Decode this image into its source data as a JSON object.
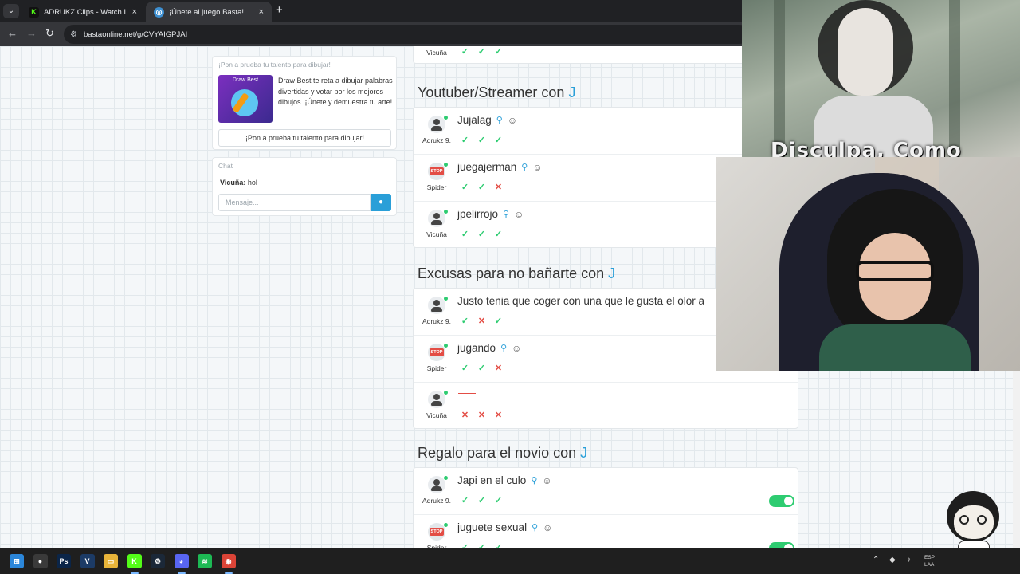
{
  "browser": {
    "tabs": [
      {
        "title": "ADRUKZ Clips - Watch Live on",
        "close": "×"
      },
      {
        "title": "¡Únete al juego Basta!",
        "close": "×"
      }
    ],
    "new_tab": "+",
    "url": "bastaonline.net/g/CVYAIGPJAI"
  },
  "promo": {
    "header": "¡Pon a prueba tu talento para dibujar!",
    "image_label": "Draw Best",
    "text": "Draw Best te reta a dibujar palabras divertidas y votar por los mejores dibujos. ¡Únete y demuestra tu arte!",
    "button": "¡Pon a prueba tu talento para dibujar!"
  },
  "chat": {
    "header": "Chat",
    "messages": [
      {
        "user": "Vicuña:",
        "text": " hol"
      }
    ],
    "placeholder": "Mensaje..."
  },
  "top_row": {
    "player": "Vicuña",
    "votes": [
      "ok",
      "ok",
      "ok"
    ]
  },
  "categories": [
    {
      "title": "Youtuber/Streamer con",
      "letter": "J",
      "answers": [
        {
          "player": "Adrukz 9.",
          "avatar": "person",
          "answer": "Jujalag",
          "votes": [
            "ok",
            "ok",
            "ok"
          ]
        },
        {
          "player": "Spider",
          "avatar": "stop",
          "answer": "juegajerman",
          "votes": [
            "ok",
            "ok",
            "no"
          ]
        },
        {
          "player": "Vicuña",
          "avatar": "person",
          "answer": "jpelirrojo",
          "votes": [
            "ok",
            "ok",
            "ok"
          ]
        }
      ]
    },
    {
      "title": "Excusas para no bañarte con",
      "letter": "J",
      "answers": [
        {
          "player": "Adrukz 9.",
          "avatar": "person",
          "answer": "Justo tenia que coger con una que le gusta el olor a",
          "votes": [
            "ok",
            "no",
            "ok"
          ]
        },
        {
          "player": "Spider",
          "avatar": "stop",
          "answer": "jugando",
          "votes": [
            "ok",
            "ok",
            "no"
          ]
        },
        {
          "player": "Vicuña",
          "avatar": "person",
          "answer": "",
          "votes": [
            "no",
            "no",
            "no"
          ]
        }
      ]
    },
    {
      "title": "Regalo para el novio con",
      "letter": "J",
      "answers": [
        {
          "player": "Adrukz 9.",
          "avatar": "person",
          "answer": "Japi en el culo",
          "votes": [
            "ok",
            "ok",
            "ok"
          ]
        },
        {
          "player": "Spider",
          "avatar": "stop",
          "answer": "juguete sexual",
          "votes": [
            "ok",
            "ok",
            "ok"
          ]
        }
      ]
    }
  ],
  "icons": {
    "ok": "✓",
    "no": "✕",
    "search": "search-icon",
    "emoji": "emoji-icon"
  },
  "overlay": {
    "caption": "Disculpa, Como"
  },
  "taskbar": {
    "apps": [
      "start",
      "obs",
      "photoshop",
      "vegas",
      "explorer",
      "kick",
      "steam",
      "discord",
      "spotify",
      "chrome"
    ],
    "tray_text": "ESP\nLAA"
  }
}
